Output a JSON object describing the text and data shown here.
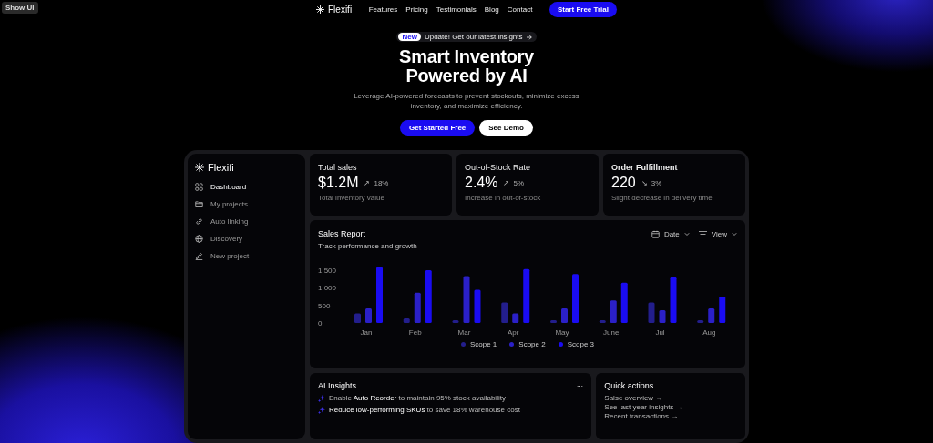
{
  "show_ui_button": "Show UI",
  "nav": {
    "logo": "Flexifi",
    "links": [
      "Features",
      "Pricing",
      "Testimonials",
      "Blog",
      "Contact"
    ],
    "cta": "Start Free Trial"
  },
  "hero": {
    "badge": "New",
    "announcement": "Update! Get our latest insights",
    "title_lines": [
      "Smart Inventory",
      "Powered by AI"
    ],
    "subtitle": "Leverage AI-powered forecasts to prevent stockouts, minimize excess inventory, and maximize efficiency.",
    "primary_button": "Get Started Free",
    "secondary_button": "See Demo"
  },
  "dashboard": {
    "logo": "Flexifi",
    "sidebar": [
      {
        "label": "Dashboard",
        "selected": true
      },
      {
        "label": "My projects",
        "selected": false
      },
      {
        "label": "Auto linking",
        "selected": false
      },
      {
        "label": "Discovery",
        "selected": false
      },
      {
        "label": "New project",
        "selected": false
      }
    ],
    "stats": [
      {
        "title": "Total sales",
        "value": "$1.2M",
        "trend_arrow": "↗",
        "change": "18%",
        "note": "Total inventory value"
      },
      {
        "title": "Out-of-Stock Rate",
        "value": "2.4%",
        "trend_arrow": "↗",
        "change": "5%",
        "note": "Increase in out-of-stock"
      },
      {
        "title": "Order Fulfillment",
        "value": "220",
        "trend_arrow": "↘",
        "change": "3%",
        "note": "Slight decrease in delivery time"
      }
    ],
    "sales_report": {
      "title": "Sales Report",
      "subtitle": "Track performance and growth",
      "date_filter": "Date",
      "view_filter": "View",
      "chart_data": {
        "type": "bar",
        "categories": [
          "Jan",
          "Feb",
          "Mar",
          "Apr",
          "May",
          "June",
          "Jul",
          "Aug"
        ],
        "series": [
          {
            "name": "Scope 1",
            "color": "#231e8c",
            "values": [
              270,
              130,
              80,
              580,
              80,
              80,
              580,
              80
            ]
          },
          {
            "name": "Scope 2",
            "color": "#2b20c8",
            "values": [
              410,
              860,
              1330,
              270,
              410,
              640,
              360,
              410
            ]
          },
          {
            "name": "Scope 3",
            "color": "#1a0cf2",
            "values": [
              1590,
              1500,
              940,
              1530,
              1390,
              1140,
              1300,
              750
            ]
          }
        ],
        "ylim": [
          0,
          1600
        ],
        "legend": "bottom",
        "yticks": [
          {
            "value": 0,
            "label": "0"
          },
          {
            "value": 500,
            "label": "500"
          },
          {
            "value": 1000,
            "label": "1,000"
          },
          {
            "value": 1500,
            "label": "1,500"
          }
        ]
      }
    },
    "ai_insights": {
      "title": "AI Insights",
      "items": [
        "Enable **Auto Reorder** to maintain 95% stock availability",
        "**Reduce low-performing SKUs** to save 18% warehouse cost"
      ]
    },
    "quick_actions": {
      "title": "Quick actions",
      "links": [
        "Salse overview →",
        "See last year insights →",
        "Recent transactions →"
      ]
    }
  }
}
